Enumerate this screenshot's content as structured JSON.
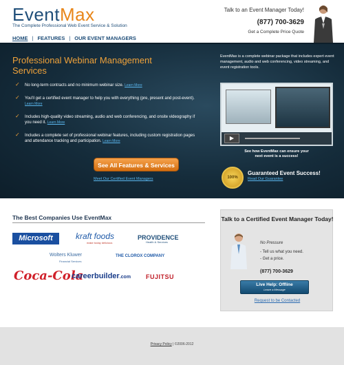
{
  "header": {
    "logo_part1": "Event",
    "logo_part2": "Max",
    "tagline": "The Complete Professional Web Event Service & Solution",
    "nav": {
      "home": "HOME",
      "features": "FEATURES",
      "managers": "OUR EVENT MANAGERS",
      "separator": "|"
    },
    "talk": "Talk to an Event Manager Today!",
    "phone": "(877) 700-3629",
    "quote": "Get a Complete Price Quote"
  },
  "hero": {
    "title": "Professional Webinar Management Services",
    "features": [
      {
        "text": "No long-term contracts and no minimum webinar size.",
        "link": "Learn More"
      },
      {
        "text": "You'll get a certified event manager to help you with everything (pre, present and post-event).",
        "link": "Learn More"
      },
      {
        "text": "Includes high-quality video streaming, audio and web conferencing, and onsite videography if you need it.",
        "link": "Learn More"
      },
      {
        "text": "Includes a complete set of professional webinar features, including custom registration pages and attendance tracking and participation.",
        "link": "Learn More"
      }
    ],
    "all_features_button": "See All Features & Services",
    "meet_link": "Meet Our Certified Event Managers",
    "description": "EventMax is a complete webinar package that includes expert event management, audio and web conferencing, video streaming, and event registration tools.",
    "video_caption": "See how EventMax can ensure your next event is a success!",
    "seal_text": "100%",
    "guarantee": "Guaranteed Event Success!",
    "guarantee_link": "Read Our Guarantee"
  },
  "companies": {
    "title": "The Best Companies Use EventMax",
    "logos": {
      "microsoft": "Microsoft",
      "kraft": "kraft foods",
      "kraft_sub": "make today delicious",
      "providence": "PROVIDENCE",
      "providence_sub": "Health & Services",
      "wolters": "Wolters Kluwer",
      "wolters_sub": "Financial Services",
      "clorox": "THE CLOROX COMPANY",
      "coke": "Coca-Cola",
      "career_main": "careerbuilder",
      "career_suffix": ".com",
      "fujitsu": "FUJITSU"
    }
  },
  "contact": {
    "title": "Talk to a Certified Event Manager Today!",
    "no_pressure": "No Pressure",
    "bullets": [
      "- Tell us what you need.",
      "- Get a price."
    ],
    "phone": "(877) 700-3629",
    "live_help": "Live Help: Offline",
    "leave_message": "Leave a Message",
    "request_link": "Request to be Contacted"
  },
  "footer": {
    "privacy": "Privacy Policy",
    "copyright": "| ©2006-2012"
  },
  "colors": {
    "brand_blue": "#1f4e79",
    "brand_orange": "#e8861a",
    "hero_bg": "#152c3b",
    "link_blue": "#5bb8f0"
  },
  "icons": {
    "check": "✓",
    "play": "▶"
  }
}
